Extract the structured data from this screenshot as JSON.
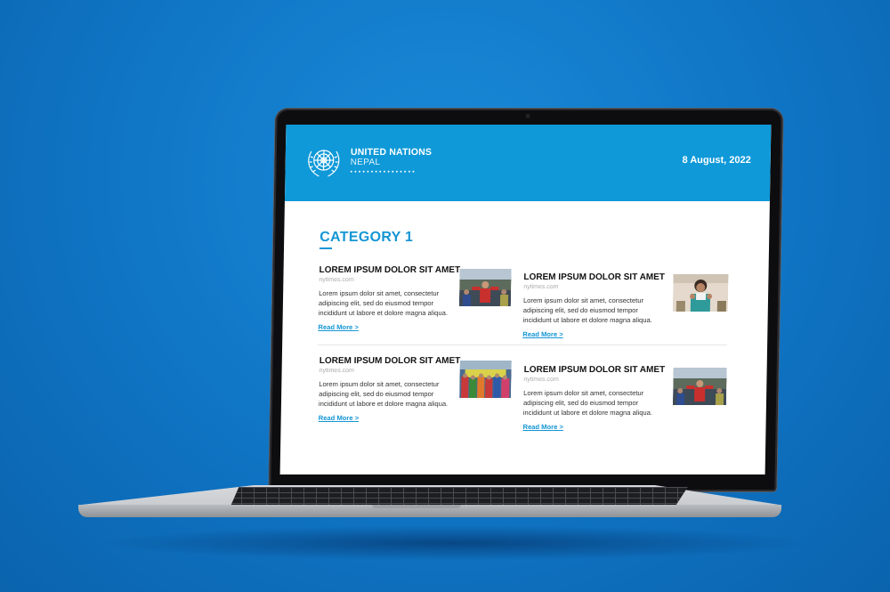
{
  "header": {
    "org_name": "UNITED NATIONS",
    "org_sub": "NEPAL",
    "dots": "••••••••••••••••",
    "date": "8 August, 2022"
  },
  "section": {
    "title": "CATEGORY 1"
  },
  "articles": [
    {
      "title": "LOREM IPSUM DOLOR SIT AMET",
      "source": "nytimes.com",
      "body": "Lorem ipsum dolor sit amet, consectetur adipiscing elit, sed do eiusmod tempor incididunt ut labore et dolore magna aliqua.",
      "link": "Read More >"
    },
    {
      "title": "LOREM IPSUM DOLOR SIT AMET",
      "source": "nytimes.com",
      "body": "Lorem ipsum dolor sit amet, consectetur adipiscing elit, sed do eiusmod tempor incididunt ut labore et dolore magna aliqua.",
      "link": "Read More >"
    },
    {
      "title": "LOREM IPSUM DOLOR SIT AMET",
      "source": "nytimes.com",
      "body": "Lorem ipsum dolor sit amet, consectetur adipiscing elit, sed do eiusmod tempor incididunt ut labore et dolore magna aliqua.",
      "link": "Read More >"
    },
    {
      "title": "LOREM IPSUM DOLOR SIT AMET",
      "source": "nytimes.com",
      "body": "Lorem ipsum dolor sit amet, consectetur adipiscing elit, sed do eiusmod tempor incididunt ut labore et dolore magna aliqua.",
      "link": "Read More >"
    }
  ],
  "colors": {
    "background": "#0f74c4",
    "header": "#0f99d8",
    "accent": "#1596d4"
  },
  "icons": {
    "logo": "un-emblem-icon"
  }
}
